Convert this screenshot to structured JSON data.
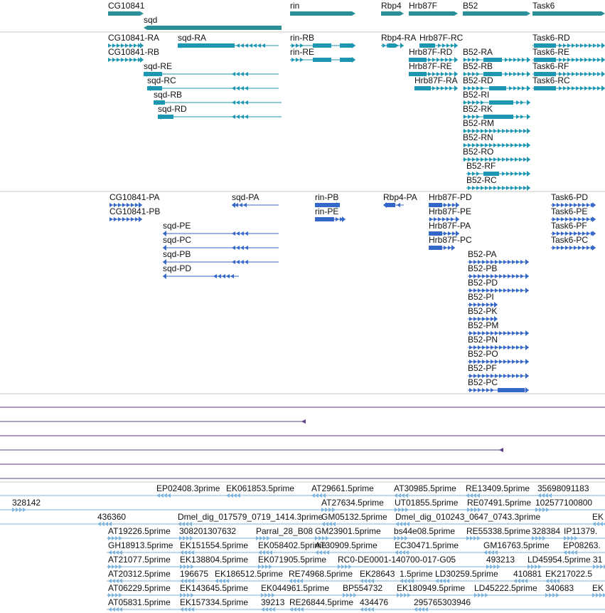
{
  "colors": {
    "gene": "#2b8f97",
    "transcript": "#1d97b1",
    "protein": "#3567c8",
    "alignment": "#5b3a8c",
    "est": "#7fb4dc",
    "divider": "#c8c8c8"
  },
  "genes": [
    {
      "name": "CG10841",
      "strand": "+"
    },
    {
      "name": "sqd",
      "strand": "-"
    },
    {
      "name": "rin",
      "strand": "+"
    },
    {
      "name": "Rbp4",
      "strand": "+"
    },
    {
      "name": "Hrb87F",
      "strand": "+"
    },
    {
      "name": "B52",
      "strand": "+"
    },
    {
      "name": "Task6",
      "strand": "+"
    }
  ],
  "transcripts": [
    {
      "name": "CG10841-RA",
      "strand": "+"
    },
    {
      "name": "CG10841-RB",
      "strand": "+"
    },
    {
      "name": "sqd-RA",
      "strand": "-"
    },
    {
      "name": "sqd-RE",
      "strand": "-"
    },
    {
      "name": "sqd-RC",
      "strand": "-"
    },
    {
      "name": "sqd-RB",
      "strand": "-"
    },
    {
      "name": "sqd-RD",
      "strand": "-"
    },
    {
      "name": "rin-RB",
      "strand": "+"
    },
    {
      "name": "rin-RE",
      "strand": "+"
    },
    {
      "name": "Rbp4-RA",
      "strand": "+"
    },
    {
      "name": "Hrb87F-RC",
      "strand": "+"
    },
    {
      "name": "Hrb87F-RD",
      "strand": "+"
    },
    {
      "name": "Hrb87F-RE",
      "strand": "+"
    },
    {
      "name": "Hrb87F-RA",
      "strand": "+"
    },
    {
      "name": "B52-RA",
      "strand": "+"
    },
    {
      "name": "B52-RB",
      "strand": "+"
    },
    {
      "name": "B52-RD",
      "strand": "+"
    },
    {
      "name": "B52-RI",
      "strand": "+"
    },
    {
      "name": "B52-RK",
      "strand": "+"
    },
    {
      "name": "B52-RM",
      "strand": "+"
    },
    {
      "name": "B52-RN",
      "strand": "+"
    },
    {
      "name": "B52-RO",
      "strand": "+"
    },
    {
      "name": "B52-RF",
      "strand": "+"
    },
    {
      "name": "B52-RC",
      "strand": "+"
    },
    {
      "name": "Task6-RD",
      "strand": "+"
    },
    {
      "name": "Task6-RE",
      "strand": "+"
    },
    {
      "name": "Task6-RF",
      "strand": "+"
    },
    {
      "name": "Task6-RC",
      "strand": "+"
    }
  ],
  "proteins": [
    {
      "name": "CG10841-PA",
      "strand": "+"
    },
    {
      "name": "CG10841-PB",
      "strand": "+"
    },
    {
      "name": "sqd-PA",
      "strand": "-"
    },
    {
      "name": "sqd-PE",
      "strand": "-"
    },
    {
      "name": "sqd-PC",
      "strand": "-"
    },
    {
      "name": "sqd-PB",
      "strand": "-"
    },
    {
      "name": "sqd-PD",
      "strand": "-"
    },
    {
      "name": "rin-PB",
      "strand": "+"
    },
    {
      "name": "rin-PE",
      "strand": "+"
    },
    {
      "name": "Rbp4-PA",
      "strand": "-"
    },
    {
      "name": "Hrb87F-PD",
      "strand": "+"
    },
    {
      "name": "Hrb87F-PE",
      "strand": "+"
    },
    {
      "name": "Hrb87F-PA",
      "strand": "+"
    },
    {
      "name": "Hrb87F-PC",
      "strand": "+"
    },
    {
      "name": "B52-PA",
      "strand": "+"
    },
    {
      "name": "B52-PB",
      "strand": "+"
    },
    {
      "name": "B52-PD",
      "strand": "+"
    },
    {
      "name": "B52-PI",
      "strand": "+"
    },
    {
      "name": "B52-PK",
      "strand": "+"
    },
    {
      "name": "B52-PM",
      "strand": "+"
    },
    {
      "name": "B52-PN",
      "strand": "+"
    },
    {
      "name": "B52-PO",
      "strand": "+"
    },
    {
      "name": "B52-PF",
      "strand": "+"
    },
    {
      "name": "B52-PC",
      "strand": "+"
    },
    {
      "name": "Task6-PD",
      "strand": "+"
    },
    {
      "name": "Task6-PE",
      "strand": "+"
    },
    {
      "name": "Task6-PF",
      "strand": "+"
    },
    {
      "name": "Task6-PC",
      "strand": "+"
    }
  ],
  "est_labels": [
    "EP02408.3prime",
    "EK061853.5prime",
    "AT29661.5prime",
    "AT30985.5prime",
    "RE13409.5prime",
    "35698091183",
    "328142",
    "AT27634.5prime",
    "UT01855.5prime",
    "RE07491.5prime",
    "102577100800",
    "436360",
    "Dmel_dig_017579_0719_1414.3prime",
    "GM05132.5prime",
    "Dmel_dig_010243_0647_0743.3prime",
    "EK",
    "AT19226.5prime",
    "308201307632",
    "Parral_28_B08",
    "GM23901.5prime",
    "bs44e08.5prime",
    "RE55338.5prime",
    "328384",
    "IP11379.",
    "GH18913.5prime",
    "EK151554.5prime",
    "EK058402.5prime",
    "AT30909.5prime",
    "EC30471.5prime",
    "GM16763.5prime",
    "EP08263.",
    "AT21077.5prime",
    "EK138804.5prime",
    "EK071905.5prime",
    "RC0-DE0001-140700-017-G05",
    "493213",
    "LD45954.5prime",
    "31",
    "AT20312.5prime",
    "196675",
    "EK186512.5prime",
    "RE74968.5prime",
    "EK28643",
    "1.5prime",
    "LD30259.5prime",
    "410881",
    "EK217022.5",
    "AT06229.5prime",
    "EK143645.5prime",
    "EK044961.5prime",
    "BP554732",
    "EK180949.5prime",
    "LD45222.5prime",
    "340683",
    "EK",
    "AT05831.5prime",
    "EK157334.5prime",
    "39213",
    "RE26844.5prime",
    "434476",
    "295765303946"
  ]
}
